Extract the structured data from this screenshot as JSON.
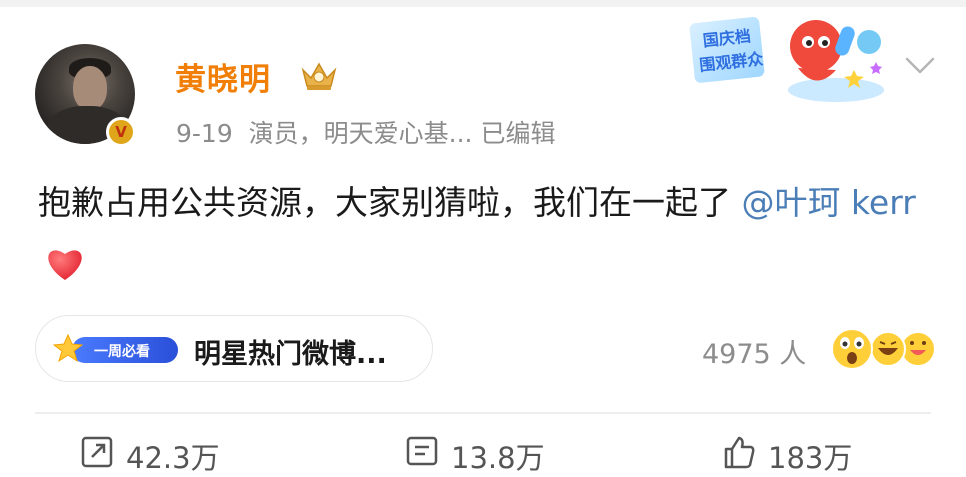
{
  "post": {
    "author": "黄晓明",
    "date": "9-19",
    "description": "演员，明天爱心基...",
    "edited": "已编辑",
    "text_main": "抱歉占用公共资源，大家别猜啦，我们在一起了 ",
    "mention": "@叶珂 kerr"
  },
  "banner": {
    "line1": "国庆档",
    "line2": "围观群众"
  },
  "hot_topic": {
    "badge": "一周必看",
    "label": "明星热门微博..."
  },
  "reactions": {
    "count": "4975 人"
  },
  "actions": {
    "repost": "42.3万",
    "comment": "13.8万",
    "like": "183万"
  },
  "colors": {
    "username": "#f17e06",
    "mention": "#4b7eb6",
    "meta": "#8c8c8c"
  }
}
